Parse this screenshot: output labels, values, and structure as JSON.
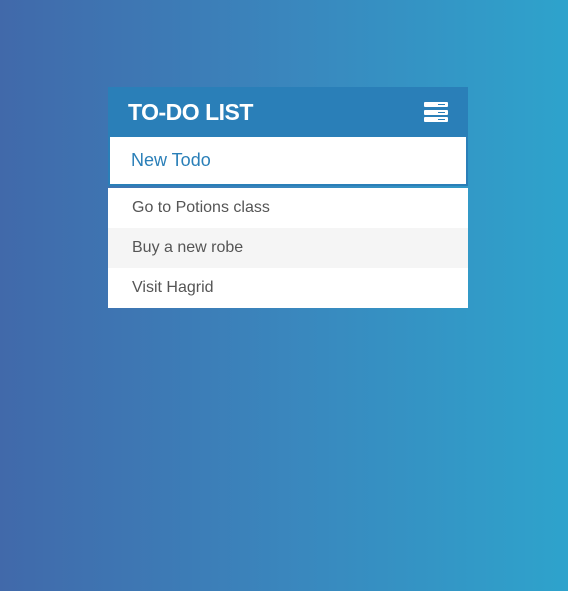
{
  "header": {
    "title": "TO-DO LIST",
    "menu_icon": "menu-icon"
  },
  "input": {
    "value": "New Todo"
  },
  "todos": [
    {
      "label": "Go to Potions class"
    },
    {
      "label": "Buy a new robe"
    },
    {
      "label": "Visit Hagrid"
    }
  ],
  "colors": {
    "accent": "#2a7fb8",
    "gradient_left": "#4169aa",
    "gradient_right": "#2ea3cc"
  }
}
